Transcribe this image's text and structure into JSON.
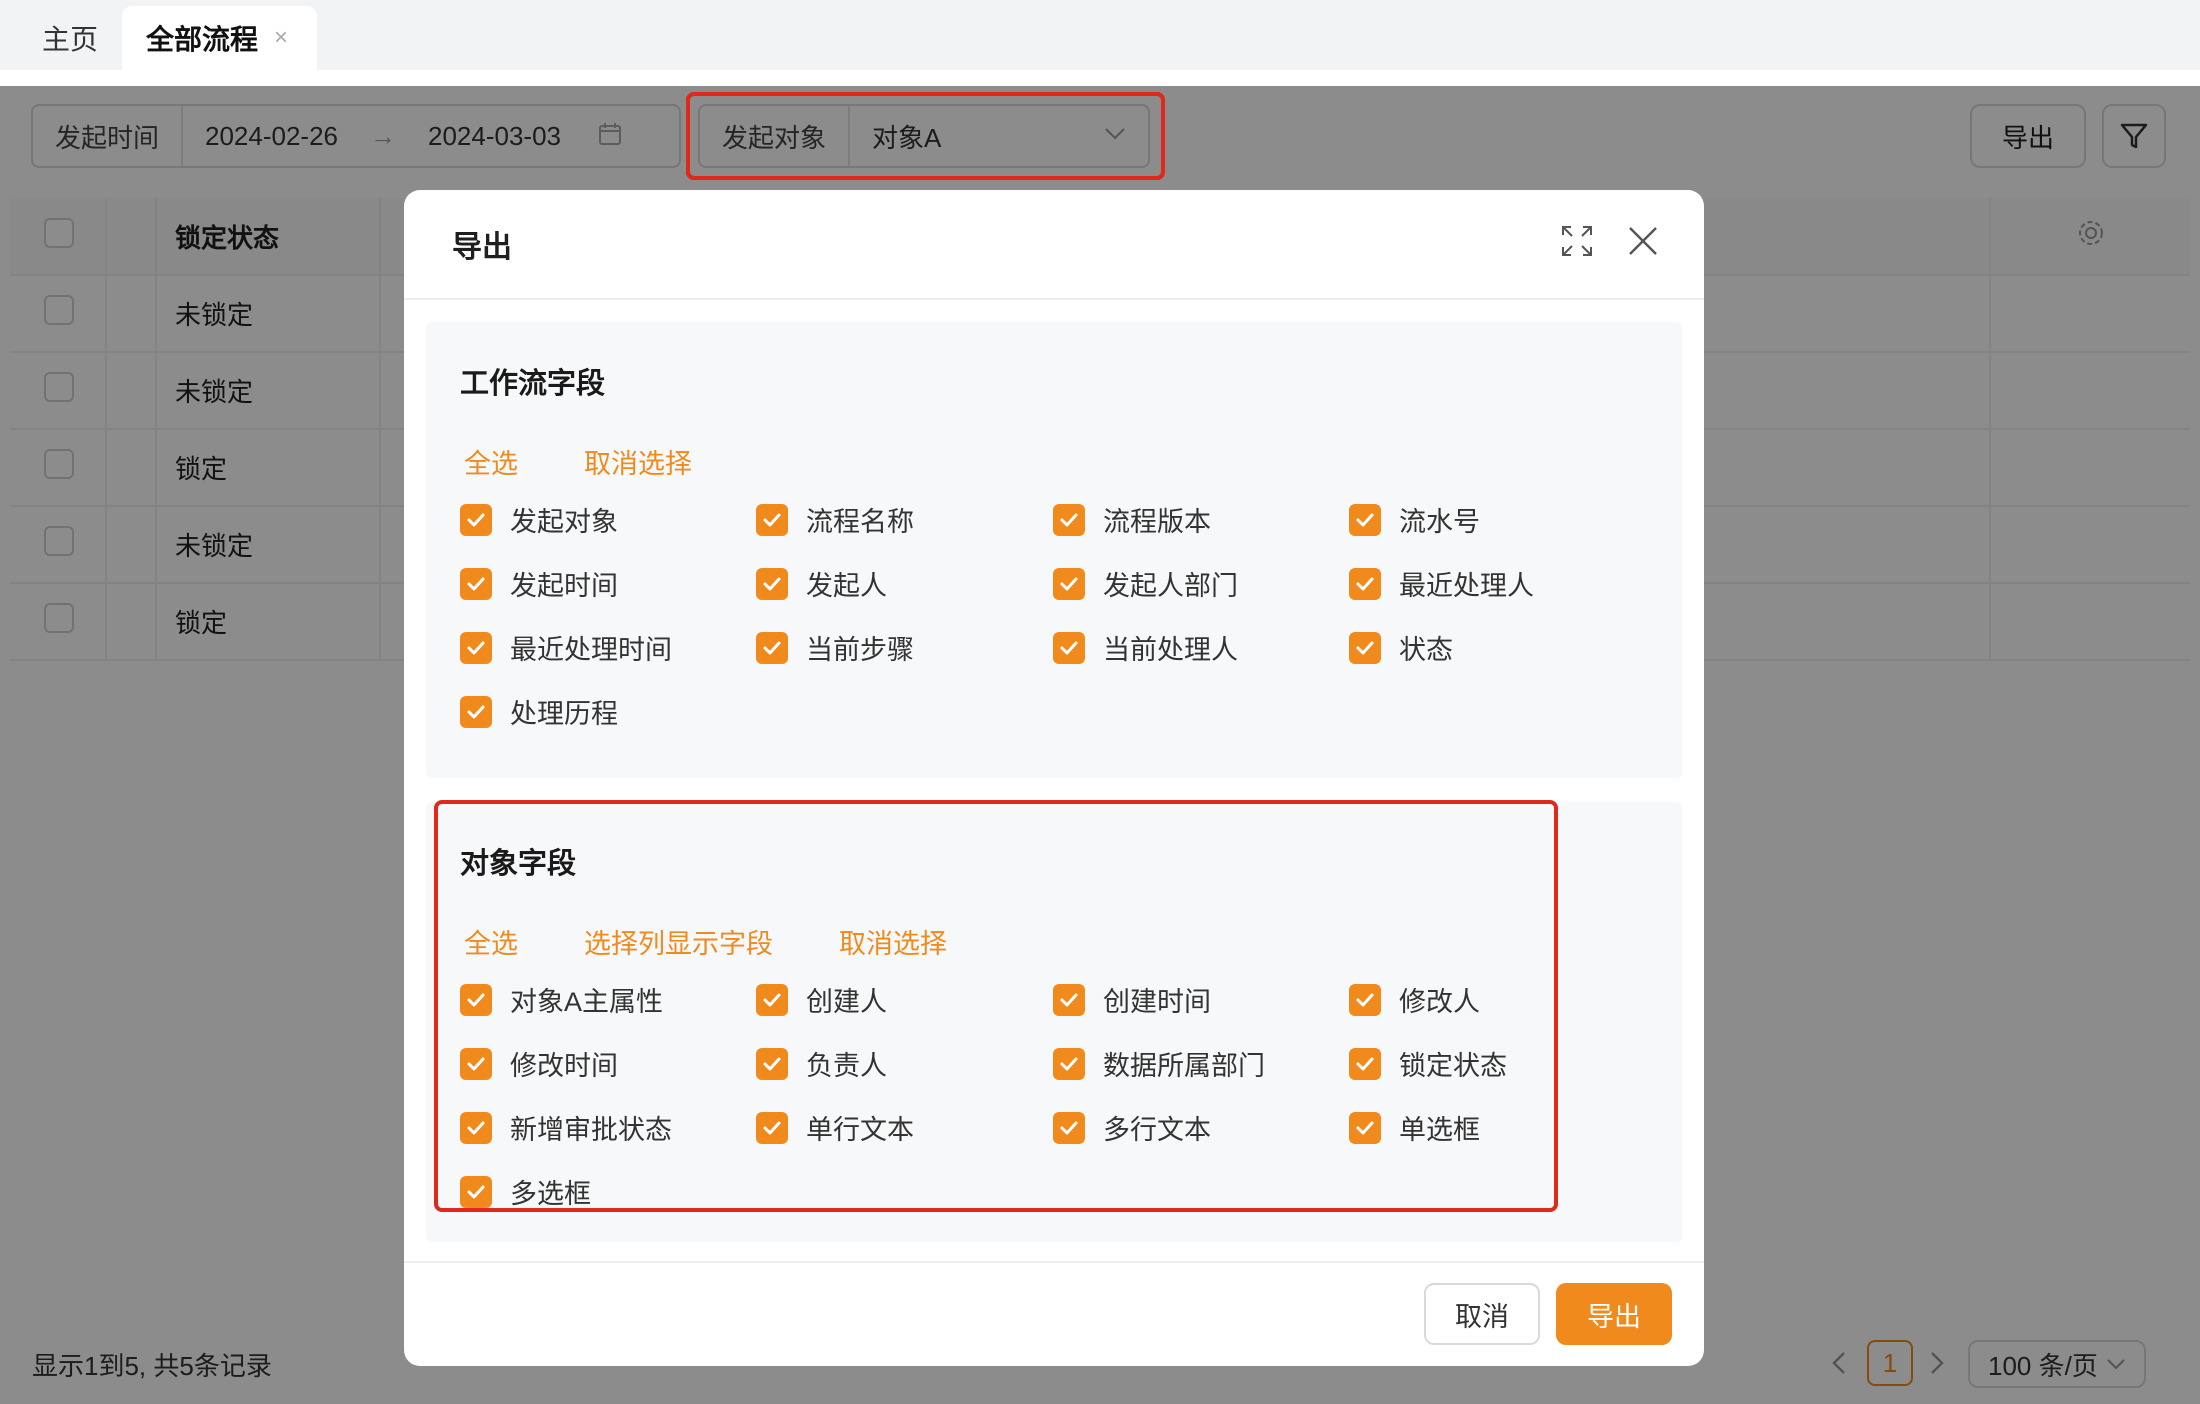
{
  "tabs": {
    "home": "主页",
    "active": "全部流程",
    "close": "×"
  },
  "filters": {
    "time_label": "发起时间",
    "date_start": "2024-02-26",
    "date_sep": "→",
    "date_end": "2024-03-03",
    "object_label": "发起对象",
    "object_value": "对象A"
  },
  "toolbar": {
    "export_label": "导出"
  },
  "table": {
    "header": "锁定状态",
    "rows": [
      "未锁定",
      "未锁定",
      "锁定",
      "未锁定",
      "锁定"
    ]
  },
  "footer": {
    "info": "显示1到5, 共5条记录",
    "page": "1",
    "page_size": "100 条/页"
  },
  "modal": {
    "title": "导出",
    "workflow_section": {
      "title": "工作流字段",
      "select_all": "全选",
      "deselect": "取消选择",
      "fields": [
        "发起对象",
        "流程名称",
        "流程版本",
        "流水号",
        "发起时间",
        "发起人",
        "发起人部门",
        "最近处理人",
        "最近处理时间",
        "当前步骤",
        "当前处理人",
        "状态",
        "处理历程"
      ]
    },
    "object_section": {
      "title": "对象字段",
      "select_all": "全选",
      "select_columns": "选择列显示字段",
      "deselect": "取消选择",
      "fields": [
        "对象A主属性",
        "创建人",
        "创建时间",
        "修改人",
        "修改时间",
        "负责人",
        "数据所属部门",
        "锁定状态",
        "新增审批状态",
        "单行文本",
        "多行文本",
        "单选框",
        "多选框"
      ]
    },
    "cancel_label": "取消",
    "export_label": "导出"
  },
  "colors": {
    "accent": "#f08a1c",
    "highlight": "#e0291b"
  }
}
